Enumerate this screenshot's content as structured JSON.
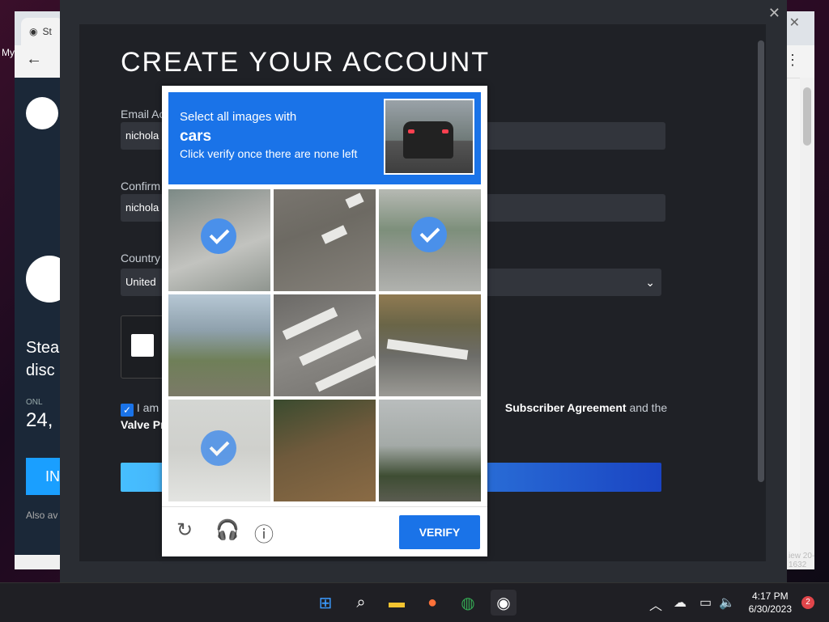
{
  "background_window": {
    "tab_label": "St",
    "side_label": "My",
    "steam_text": "Stea disc",
    "online_label": "ONL",
    "online_count": "24,",
    "install_label": "IN",
    "also_label": "Also av",
    "edge_text": "iew 20-1632"
  },
  "dialog": {
    "title": "CREATE YOUR ACCOUNT",
    "email_label": "Email Ac",
    "email_value": "nichola",
    "confirm_label": "Confirm",
    "confirm_value": "nichola",
    "country_label": "Country",
    "country_value": "United",
    "agree_prefix": "I am",
    "agree_link1": "Subscriber Agreement",
    "agree_mid": "and the",
    "agree_link2": "Valve Pr"
  },
  "recaptcha": {
    "line1": "Select all images with",
    "target": "cars",
    "line3": "Click verify once there are none left",
    "verify_label": "VERIFY",
    "tiles_selected": [
      true,
      false,
      true,
      false,
      false,
      false,
      true,
      false,
      false
    ]
  },
  "taskbar": {
    "time": "4:17 PM",
    "date": "6/30/2023",
    "notifications": "2"
  },
  "colors": {
    "accent": "#1a73e8",
    "steam_bg": "#1f2126"
  }
}
